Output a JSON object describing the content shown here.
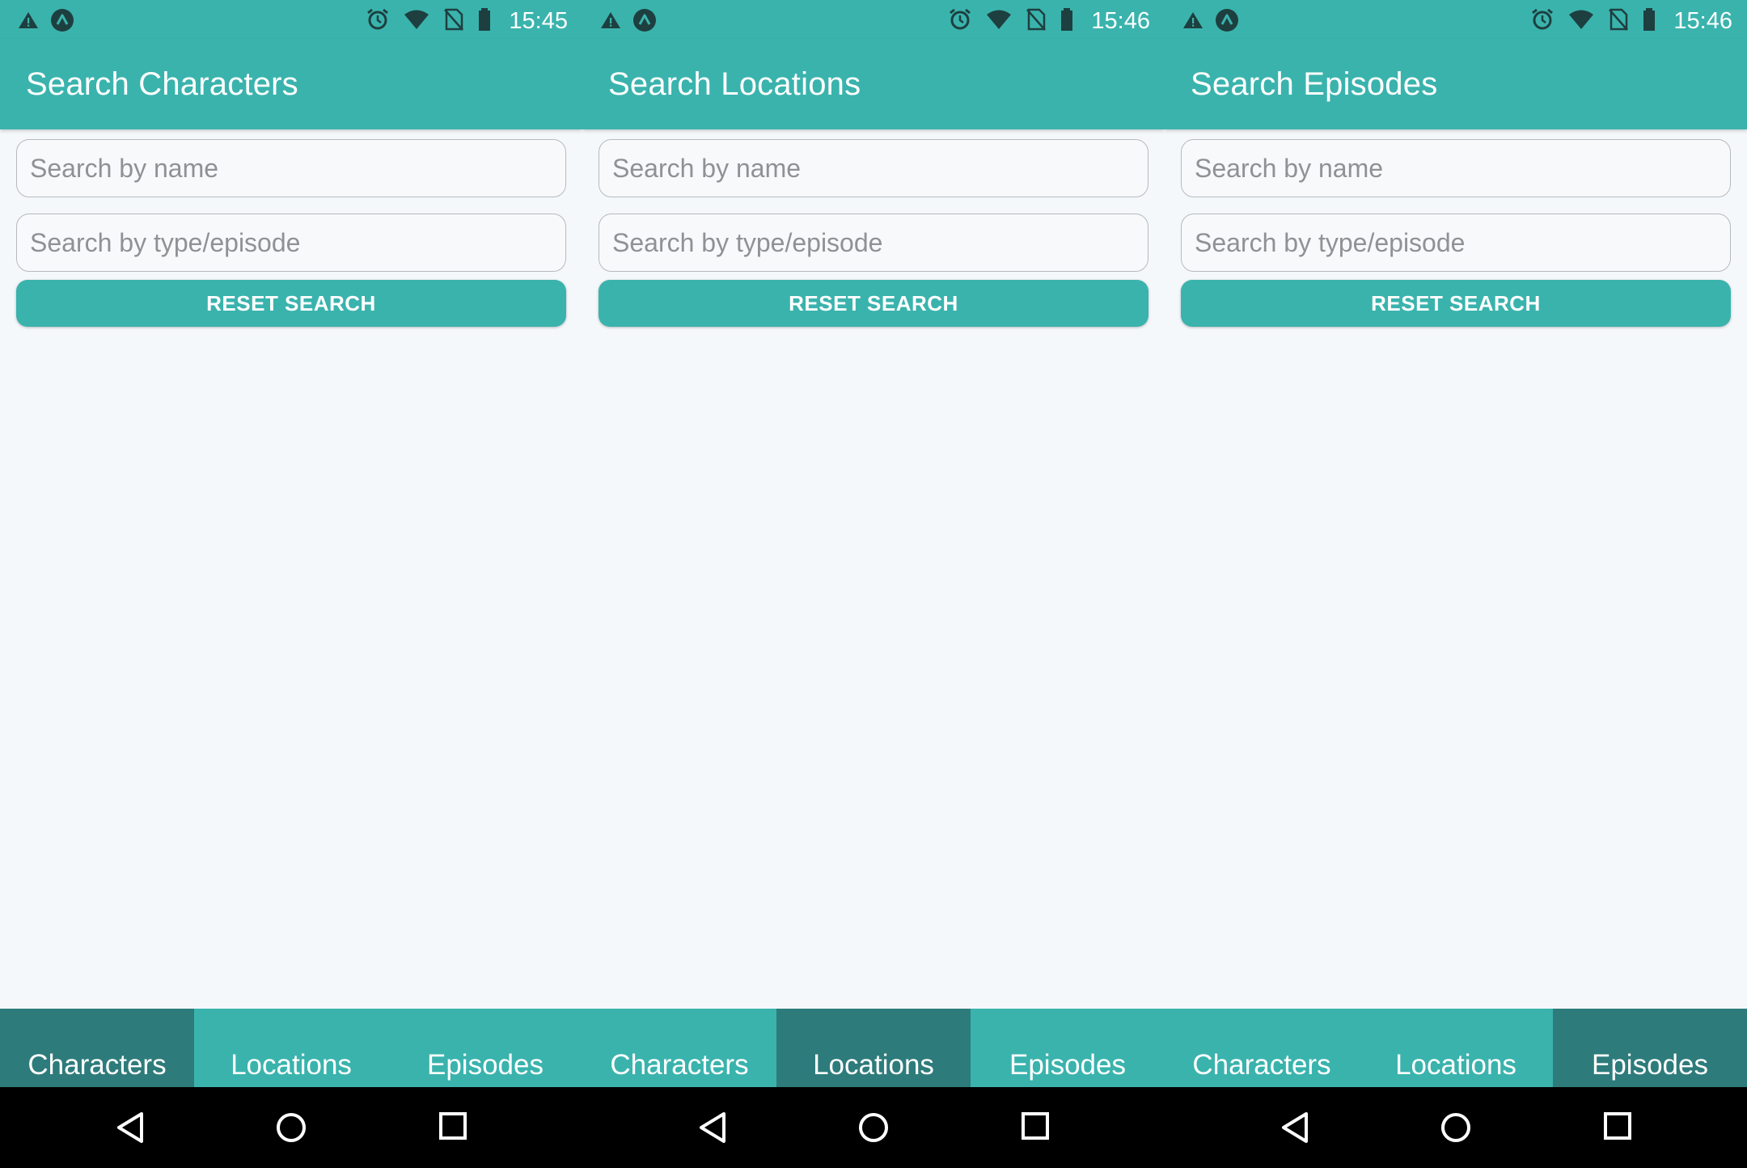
{
  "screens": [
    {
      "status_time": "15:45",
      "title": "Search Characters",
      "name_placeholder": "Search by name",
      "type_placeholder": "Search by type/episode",
      "reset_label": "RESET SEARCH",
      "tabs": [
        {
          "label": "Characters",
          "active": true
        },
        {
          "label": "Locations",
          "active": false
        },
        {
          "label": "Episodes",
          "active": false
        }
      ]
    },
    {
      "status_time": "15:46",
      "title": "Search Locations",
      "name_placeholder": "Search by name",
      "type_placeholder": "Search by type/episode",
      "reset_label": "RESET SEARCH",
      "tabs": [
        {
          "label": "Characters",
          "active": false
        },
        {
          "label": "Locations",
          "active": true
        },
        {
          "label": "Episodes",
          "active": false
        }
      ]
    },
    {
      "status_time": "15:46",
      "title": "Search Episodes",
      "name_placeholder": "Search by name",
      "type_placeholder": "Search by type/episode",
      "reset_label": "RESET SEARCH",
      "tabs": [
        {
          "label": "Characters",
          "active": false
        },
        {
          "label": "Locations",
          "active": false
        },
        {
          "label": "Episodes",
          "active": true
        }
      ]
    }
  ],
  "colors": {
    "primary": "#3ab3ad",
    "tab_active": "#2e7b7b",
    "background": "#f5f8fb",
    "navbar": "#000000"
  },
  "icons": {
    "status_left": [
      "warning-icon",
      "app-notification-icon"
    ],
    "status_right": [
      "alarm-icon",
      "wifi-icon",
      "no-sim-icon",
      "battery-icon"
    ],
    "navigation": [
      "back-icon",
      "home-icon",
      "recents-icon"
    ]
  }
}
